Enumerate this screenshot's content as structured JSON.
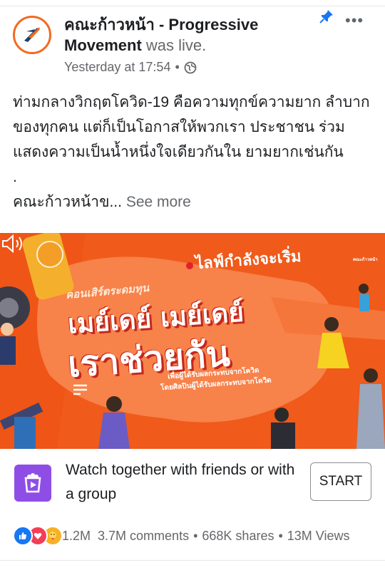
{
  "post": {
    "author_name": "คณะก้าวหน้า - Progressive Movement",
    "live_suffix": "was live.",
    "timestamp": "Yesterday at 17:54",
    "dot": "•",
    "text_lines": [
      "ท่ามกลางวิกฤตโควิด-19 คือความทุกข์ความยาก ลำบากของทุกคน แต่ก็เป็นโอกาสให้พวกเรา ประชาชน ร่วมแสดงความเป็นน้ำหนึ่งใจเดียวกันใน ยามยากเช่นกัน",
      "."
    ],
    "truncated_text": "คณะก้าวหน้าข...",
    "see_more": "See more"
  },
  "video": {
    "live_starting": "ไลฟ์กำลังจะเริ่ม",
    "concert_label": "คอนเสิร์ตระดมทุน",
    "title_line1": "เมย์เดย์ เมย์เดย์",
    "title_line2": "เราช่วยกัน",
    "subtitle_line1": "เพื่อผู้ได้รับผลกระทบจากโควิด",
    "subtitle_line2": "โดยศิลปินผู้ได้รับผลกระทบจากโควิด",
    "brand_text": "คณะก้าวหน้า",
    "colors": {
      "background": "#f05a1a",
      "accent_red": "#c4271c"
    }
  },
  "watch_together": {
    "text": "Watch together with friends or with a group",
    "start_label": "START"
  },
  "reactions": {
    "count": "1.2M",
    "comments": "3.7M comments",
    "shares": "668K shares",
    "views": "13M Views",
    "separator": "•",
    "icons": [
      "like-icon",
      "love-icon",
      "care-icon"
    ]
  }
}
